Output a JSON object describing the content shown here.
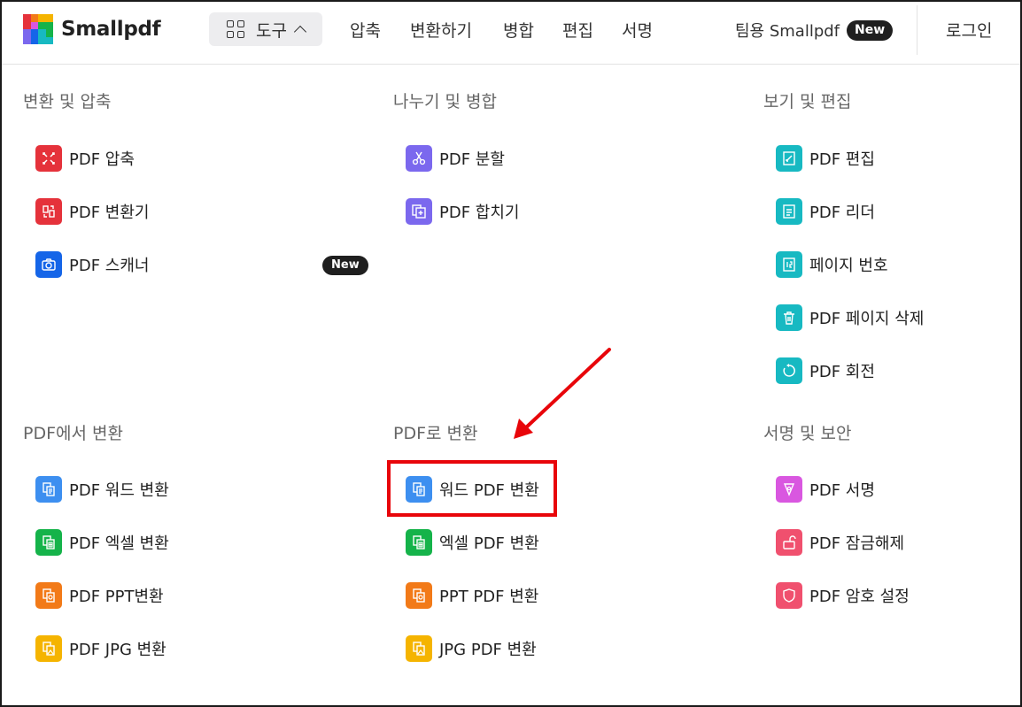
{
  "header": {
    "logo_text": "Smallpdf",
    "tools_label": "도구",
    "nav": [
      "압축",
      "변환하기",
      "병합",
      "편집",
      "서명"
    ],
    "team_label": "팀용 Smallpdf",
    "team_badge": "New",
    "login": "로그인"
  },
  "columns": {
    "convert_compress": {
      "title": "변환 및 압축",
      "items": [
        {
          "label": "PDF 압축",
          "color": "#e5323b",
          "icon": "compress-icon"
        },
        {
          "label": "PDF 변환기",
          "color": "#e5323b",
          "icon": "convert-icon"
        },
        {
          "label": "PDF 스캐너",
          "color": "#1565e8",
          "icon": "camera-icon",
          "badge": "New"
        }
      ]
    },
    "split_merge": {
      "title": "나누기 및 병합",
      "items": [
        {
          "label": "PDF 분할",
          "color": "#7b68ee",
          "icon": "scissors-icon"
        },
        {
          "label": "PDF 합치기",
          "color": "#7b68ee",
          "icon": "merge-icon"
        }
      ]
    },
    "view_edit": {
      "title": "보기 및 편집",
      "items": [
        {
          "label": "PDF 편집",
          "color": "#17b9c2",
          "icon": "edit-icon"
        },
        {
          "label": "PDF 리더",
          "color": "#17b9c2",
          "icon": "reader-icon"
        },
        {
          "label": "페이지 번호",
          "color": "#17b9c2",
          "icon": "page-number-icon"
        },
        {
          "label": "PDF 페이지 삭제",
          "color": "#17b9c2",
          "icon": "trash-icon"
        },
        {
          "label": "PDF 회전",
          "color": "#17b9c2",
          "icon": "rotate-icon"
        }
      ]
    },
    "from_pdf": {
      "title": "PDF에서 변환",
      "items": [
        {
          "label": "PDF 워드 변환",
          "color": "#3d8ff0",
          "icon": "word-icon"
        },
        {
          "label": "PDF 엑셀 변환",
          "color": "#15b34a",
          "icon": "excel-icon"
        },
        {
          "label": "PDF PPT변환",
          "color": "#f27a18",
          "icon": "ppt-icon"
        },
        {
          "label": "PDF JPG 변환",
          "color": "#f5b400",
          "icon": "jpg-icon"
        }
      ]
    },
    "to_pdf": {
      "title": "PDF로 변환",
      "items": [
        {
          "label": "워드 PDF 변환",
          "color": "#3d8ff0",
          "icon": "word-icon"
        },
        {
          "label": "엑셀 PDF 변환",
          "color": "#15b34a",
          "icon": "excel-icon"
        },
        {
          "label": "PPT PDF 변환",
          "color": "#f27a18",
          "icon": "ppt-icon"
        },
        {
          "label": "JPG PDF 변환",
          "color": "#f5b400",
          "icon": "jpg-icon"
        }
      ]
    },
    "sign_secure": {
      "title": "서명 및 보안",
      "items": [
        {
          "label": "PDF 서명",
          "color": "#d957e0",
          "icon": "pen-icon"
        },
        {
          "label": "PDF 잠금해제",
          "color": "#f0506e",
          "icon": "unlock-icon"
        },
        {
          "label": "PDF 암호 설정",
          "color": "#f0506e",
          "icon": "shield-icon"
        }
      ]
    }
  },
  "annotation": {
    "color": "#e8050a"
  }
}
